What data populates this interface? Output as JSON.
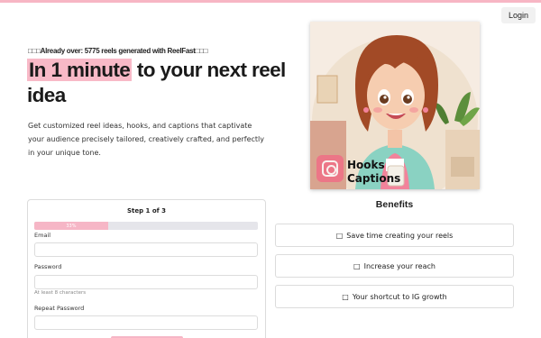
{
  "header": {
    "login_label": "Login",
    "accent_color": "#f8b9c7"
  },
  "hero": {
    "eyebrow": "□□□Already over: 5775 reels generated with ReelFast□□□",
    "headline_highlight": "In 1 minute",
    "headline_rest": " to your next reel idea",
    "subtext": "Get customized reel ideas, hooks, and captions that captivate your audience precisely tailored, creatively crafted, and perfectly in your unique tone.",
    "card_labels": [
      "Hooks",
      "Captions"
    ],
    "card_icon": "instagram-icon"
  },
  "form": {
    "step_title": "Step 1 of 3",
    "progress_percent": 33,
    "progress_label": "33%",
    "email_label": "Email",
    "email_value": "",
    "password_label": "Password",
    "password_value": "",
    "password_hint": "At least 8 characters",
    "repeat_password_label": "Repeat Password",
    "repeat_password_value": ""
  },
  "benefits": {
    "title": "Benefits",
    "items": [
      {
        "glyph": "□",
        "label": "Save time creating your reels"
      },
      {
        "glyph": "□",
        "label": "Increase your reach"
      },
      {
        "glyph": "□",
        "label": "Your shortcut to IG growth"
      }
    ]
  }
}
